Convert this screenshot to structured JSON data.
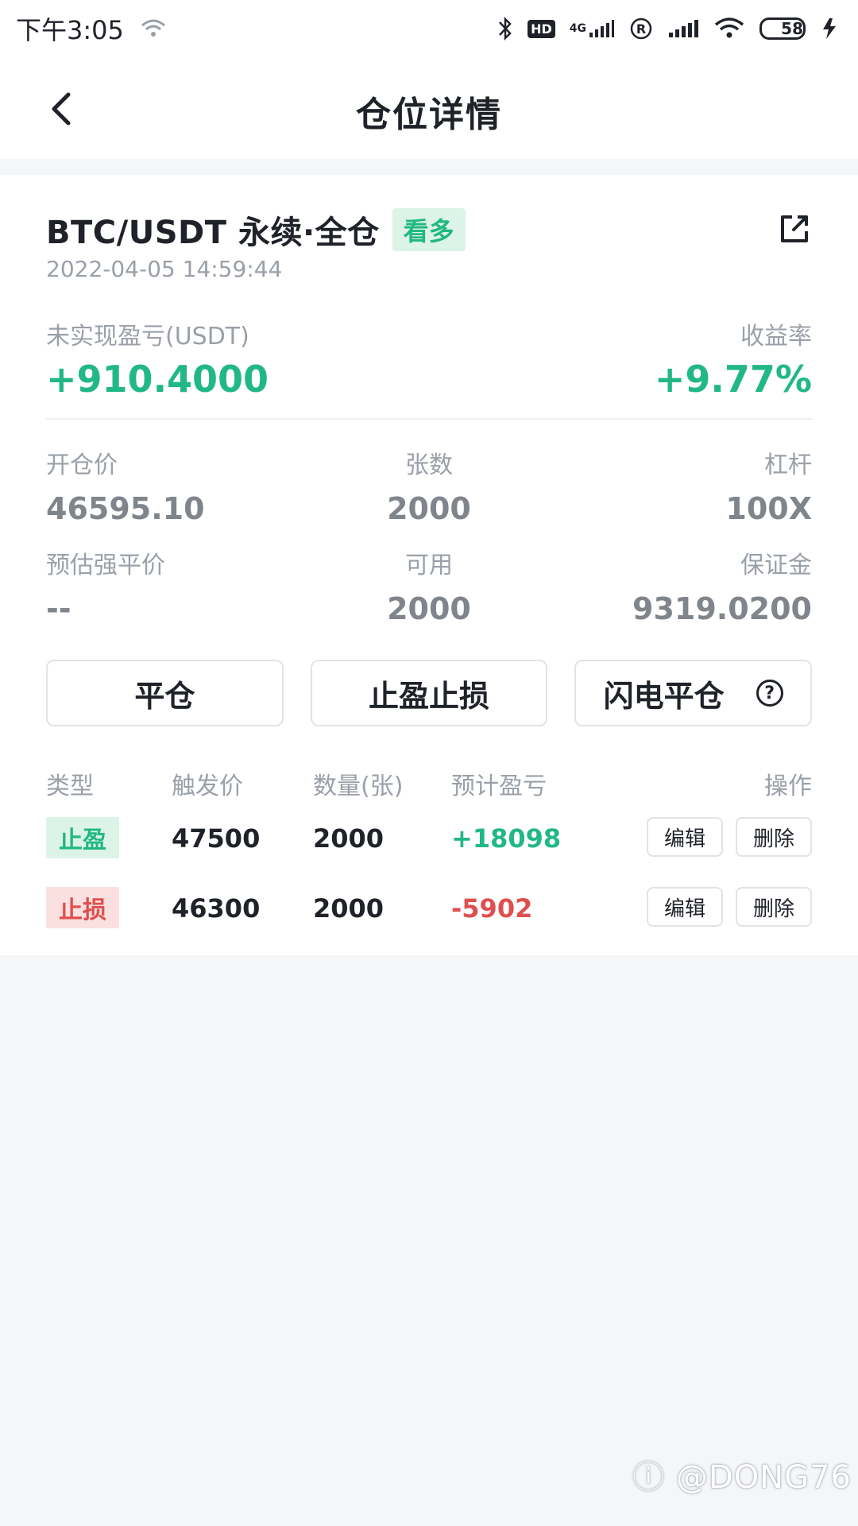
{
  "status_bar": {
    "time": "下午3:05",
    "hd": "HD",
    "network": "4G",
    "battery": "58"
  },
  "nav": {
    "title": "仓位详情"
  },
  "position": {
    "symbol": "BTC/USDT 永续·全仓",
    "side_tag": "看多",
    "timestamp": "2022-04-05 14:59:44",
    "unrealized_pnl_label": "未实现盈亏(USDT)",
    "unrealized_pnl": "+910.4000",
    "roe_label": "收益率",
    "roe": "+9.77%"
  },
  "details": {
    "open_price_label": "开仓价",
    "open_price": "46595.10",
    "contracts_label": "张数",
    "contracts": "2000",
    "leverage_label": "杠杆",
    "leverage": "100X",
    "liq_price_label": "预估强平价",
    "liq_price": "--",
    "available_label": "可用",
    "available": "2000",
    "margin_label": "保证金",
    "margin": "9319.0200"
  },
  "actions": {
    "close": "平仓",
    "tp_sl": "止盈止损",
    "flash_close": "闪电平仓"
  },
  "orders": {
    "headers": {
      "type": "类型",
      "trigger": "触发价",
      "quantity": "数量(张)",
      "est_pnl": "预计盈亏",
      "operation": "操作"
    },
    "rows": [
      {
        "type": "止盈",
        "trigger": "47500",
        "quantity": "2000",
        "est_pnl": "+18098",
        "edit": "编辑",
        "delete": "删除"
      },
      {
        "type": "止损",
        "trigger": "46300",
        "quantity": "2000",
        "est_pnl": "-5902",
        "edit": "编辑",
        "delete": "删除"
      }
    ]
  },
  "watermark": "@DONG76",
  "colors": {
    "profit": "#22b883",
    "loss": "#e04f4f",
    "muted": "#9aa0a8",
    "background": "#f5f6f8"
  }
}
